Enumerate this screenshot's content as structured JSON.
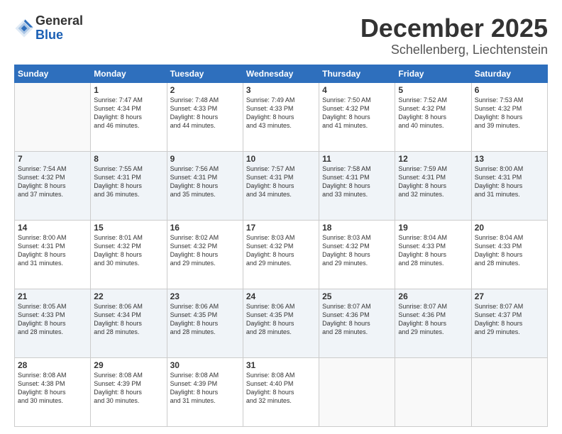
{
  "logo": {
    "general": "General",
    "blue": "Blue"
  },
  "title": "December 2025",
  "location": "Schellenberg, Liechtenstein",
  "days_header": [
    "Sunday",
    "Monday",
    "Tuesday",
    "Wednesday",
    "Thursday",
    "Friday",
    "Saturday"
  ],
  "weeks": [
    [
      {
        "day": "",
        "info": ""
      },
      {
        "day": "1",
        "info": "Sunrise: 7:47 AM\nSunset: 4:34 PM\nDaylight: 8 hours\nand 46 minutes."
      },
      {
        "day": "2",
        "info": "Sunrise: 7:48 AM\nSunset: 4:33 PM\nDaylight: 8 hours\nand 44 minutes."
      },
      {
        "day": "3",
        "info": "Sunrise: 7:49 AM\nSunset: 4:33 PM\nDaylight: 8 hours\nand 43 minutes."
      },
      {
        "day": "4",
        "info": "Sunrise: 7:50 AM\nSunset: 4:32 PM\nDaylight: 8 hours\nand 41 minutes."
      },
      {
        "day": "5",
        "info": "Sunrise: 7:52 AM\nSunset: 4:32 PM\nDaylight: 8 hours\nand 40 minutes."
      },
      {
        "day": "6",
        "info": "Sunrise: 7:53 AM\nSunset: 4:32 PM\nDaylight: 8 hours\nand 39 minutes."
      }
    ],
    [
      {
        "day": "7",
        "info": "Sunrise: 7:54 AM\nSunset: 4:32 PM\nDaylight: 8 hours\nand 37 minutes."
      },
      {
        "day": "8",
        "info": "Sunrise: 7:55 AM\nSunset: 4:31 PM\nDaylight: 8 hours\nand 36 minutes."
      },
      {
        "day": "9",
        "info": "Sunrise: 7:56 AM\nSunset: 4:31 PM\nDaylight: 8 hours\nand 35 minutes."
      },
      {
        "day": "10",
        "info": "Sunrise: 7:57 AM\nSunset: 4:31 PM\nDaylight: 8 hours\nand 34 minutes."
      },
      {
        "day": "11",
        "info": "Sunrise: 7:58 AM\nSunset: 4:31 PM\nDaylight: 8 hours\nand 33 minutes."
      },
      {
        "day": "12",
        "info": "Sunrise: 7:59 AM\nSunset: 4:31 PM\nDaylight: 8 hours\nand 32 minutes."
      },
      {
        "day": "13",
        "info": "Sunrise: 8:00 AM\nSunset: 4:31 PM\nDaylight: 8 hours\nand 31 minutes."
      }
    ],
    [
      {
        "day": "14",
        "info": "Sunrise: 8:00 AM\nSunset: 4:31 PM\nDaylight: 8 hours\nand 31 minutes."
      },
      {
        "day": "15",
        "info": "Sunrise: 8:01 AM\nSunset: 4:32 PM\nDaylight: 8 hours\nand 30 minutes."
      },
      {
        "day": "16",
        "info": "Sunrise: 8:02 AM\nSunset: 4:32 PM\nDaylight: 8 hours\nand 29 minutes."
      },
      {
        "day": "17",
        "info": "Sunrise: 8:03 AM\nSunset: 4:32 PM\nDaylight: 8 hours\nand 29 minutes."
      },
      {
        "day": "18",
        "info": "Sunrise: 8:03 AM\nSunset: 4:32 PM\nDaylight: 8 hours\nand 29 minutes."
      },
      {
        "day": "19",
        "info": "Sunrise: 8:04 AM\nSunset: 4:33 PM\nDaylight: 8 hours\nand 28 minutes."
      },
      {
        "day": "20",
        "info": "Sunrise: 8:04 AM\nSunset: 4:33 PM\nDaylight: 8 hours\nand 28 minutes."
      }
    ],
    [
      {
        "day": "21",
        "info": "Sunrise: 8:05 AM\nSunset: 4:33 PM\nDaylight: 8 hours\nand 28 minutes."
      },
      {
        "day": "22",
        "info": "Sunrise: 8:06 AM\nSunset: 4:34 PM\nDaylight: 8 hours\nand 28 minutes."
      },
      {
        "day": "23",
        "info": "Sunrise: 8:06 AM\nSunset: 4:35 PM\nDaylight: 8 hours\nand 28 minutes."
      },
      {
        "day": "24",
        "info": "Sunrise: 8:06 AM\nSunset: 4:35 PM\nDaylight: 8 hours\nand 28 minutes."
      },
      {
        "day": "25",
        "info": "Sunrise: 8:07 AM\nSunset: 4:36 PM\nDaylight: 8 hours\nand 28 minutes."
      },
      {
        "day": "26",
        "info": "Sunrise: 8:07 AM\nSunset: 4:36 PM\nDaylight: 8 hours\nand 29 minutes."
      },
      {
        "day": "27",
        "info": "Sunrise: 8:07 AM\nSunset: 4:37 PM\nDaylight: 8 hours\nand 29 minutes."
      }
    ],
    [
      {
        "day": "28",
        "info": "Sunrise: 8:08 AM\nSunset: 4:38 PM\nDaylight: 8 hours\nand 30 minutes."
      },
      {
        "day": "29",
        "info": "Sunrise: 8:08 AM\nSunset: 4:39 PM\nDaylight: 8 hours\nand 30 minutes."
      },
      {
        "day": "30",
        "info": "Sunrise: 8:08 AM\nSunset: 4:39 PM\nDaylight: 8 hours\nand 31 minutes."
      },
      {
        "day": "31",
        "info": "Sunrise: 8:08 AM\nSunset: 4:40 PM\nDaylight: 8 hours\nand 32 minutes."
      },
      {
        "day": "",
        "info": ""
      },
      {
        "day": "",
        "info": ""
      },
      {
        "day": "",
        "info": ""
      }
    ]
  ]
}
